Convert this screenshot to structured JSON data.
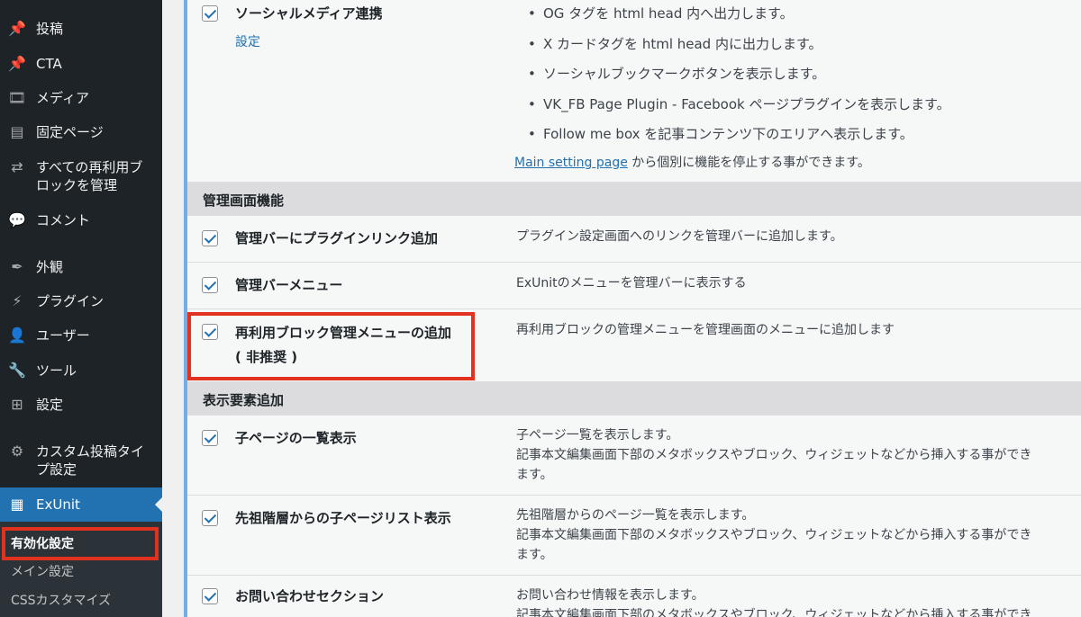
{
  "sidebar": {
    "items": [
      {
        "label": "投稿",
        "icon": "pin-icon",
        "glyph": "📌"
      },
      {
        "label": "CTA",
        "icon": "pin-icon",
        "glyph": "📌"
      },
      {
        "label": "メディア",
        "icon": "media-icon",
        "glyph": "🎞"
      },
      {
        "label": "固定ページ",
        "icon": "page-icon",
        "glyph": "▤"
      },
      {
        "label": "すべての再利用ブロックを管理",
        "icon": "reusable-block-icon",
        "glyph": "⇄"
      },
      {
        "label": "コメント",
        "icon": "comment-icon",
        "glyph": "💬"
      },
      {
        "label": "外観",
        "icon": "appearance-icon",
        "glyph": "✒"
      },
      {
        "label": "プラグイン",
        "icon": "plugin-icon",
        "glyph": "⚡"
      },
      {
        "label": "ユーザー",
        "icon": "user-icon",
        "glyph": "👤"
      },
      {
        "label": "ツール",
        "icon": "tool-icon",
        "glyph": "🔧"
      },
      {
        "label": "設定",
        "icon": "settings-icon",
        "glyph": "⊞"
      },
      {
        "label": "カスタム投稿タイプ設定",
        "icon": "gear-icon",
        "glyph": "⚙"
      },
      {
        "label": "ExUnit",
        "icon": "exunit-icon",
        "glyph": "▦"
      }
    ],
    "submenu": [
      "有効化設定",
      "メイン設定",
      "CSSカスタマイズ"
    ]
  },
  "top_row": {
    "title": "ソーシャルメディア連携",
    "link": "設定",
    "bullets": [
      "OG タグを html head 内へ出力します。",
      "X カードタグを html head 内に出力します。",
      "ソーシャルブックマークボタンを表示します。",
      "VK_FB Page Plugin - Facebook ページプラグインを表示します。",
      "Follow me box を記事コンテンツ下のエリアへ表示します。"
    ],
    "note_link": "Main setting page",
    "note_text": " から個別に機能を停止する事ができます。"
  },
  "sections": [
    {
      "label": "管理画面機能",
      "rows": [
        {
          "title": "管理バーにプラグインリンク追加",
          "desc": [
            "プラグイン設定画面へのリンクを管理バーに追加します。"
          ]
        },
        {
          "title": "管理バーメニュー",
          "desc": [
            "ExUnitのメニューを管理バーに表示する"
          ]
        },
        {
          "title": "再利用ブロック管理メニューの追加",
          "title2": "( 非推奨 )",
          "desc": [
            "再利用ブロックの管理メニューを管理画面のメニューに追加します"
          ]
        }
      ]
    },
    {
      "label": "表示要素追加",
      "rows": [
        {
          "title": "子ページの一覧表示",
          "desc": [
            "子ページ一覧を表示します。",
            "記事本文編集画面下部のメタボックスやブロック、ウィジェットなどから挿入する事ができ",
            "ます。"
          ]
        },
        {
          "title": "先祖階層からの子ページリスト表示",
          "desc": [
            "先祖階層からのページ一覧を表示します。",
            "記事本文編集画面下部のメタボックスやブロック、ウィジェットなどから挿入する事ができ",
            "ます。"
          ]
        },
        {
          "title": "お問い合わせセクション",
          "desc": [
            "お問い合わせ情報を表示します。",
            "記事本文編集画面下部のメタボックスやブロック、ウィジェットなどから挿入する事ができ"
          ]
        }
      ]
    }
  ],
  "colors": {
    "highlight": "#e0321f",
    "accent": "#2271b1"
  }
}
